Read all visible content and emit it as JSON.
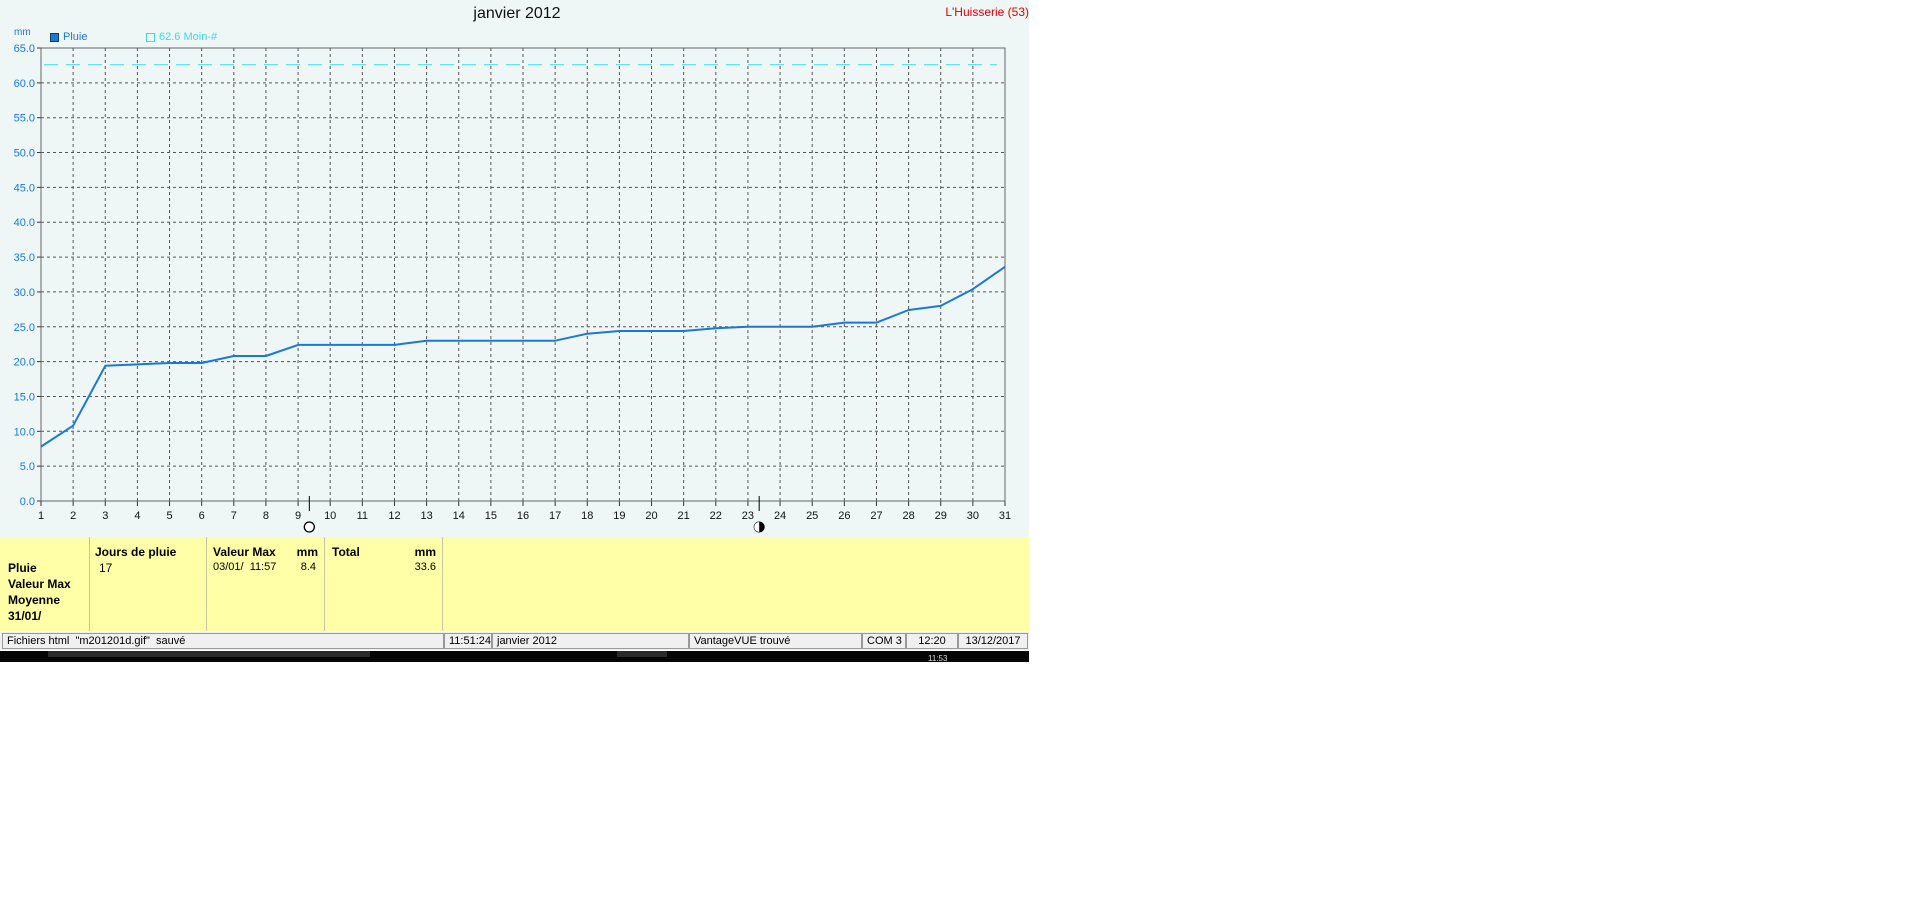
{
  "chart_data": {
    "type": "line",
    "title": "janvier 2012",
    "ylabel": "mm",
    "xlabel": "",
    "ylim": [
      0,
      65
    ],
    "xlim": [
      1,
      31
    ],
    "y_ticks": [
      "0.0",
      "5.0",
      "10.0",
      "15.0",
      "20.0",
      "25.0",
      "30.0",
      "35.0",
      "40.0",
      "45.0",
      "50.0",
      "55.0",
      "60.0",
      "65.0"
    ],
    "x_ticks": [
      "1",
      "2",
      "3",
      "4",
      "5",
      "6",
      "7",
      "8",
      "9",
      "10",
      "11",
      "12",
      "13",
      "14",
      "15",
      "16",
      "17",
      "18",
      "19",
      "20",
      "21",
      "22",
      "23",
      "24",
      "25",
      "26",
      "27",
      "28",
      "29",
      "30",
      "31"
    ],
    "grid": true,
    "legend_placement": "top-left",
    "series": [
      {
        "name": "Pluie",
        "color": "#1a78d6",
        "x": [
          1,
          2,
          3,
          4,
          5,
          6,
          7,
          8,
          9,
          10,
          11,
          12,
          13,
          14,
          15,
          16,
          17,
          18,
          19,
          20,
          21,
          22,
          23,
          24,
          25,
          26,
          27,
          28,
          29,
          30,
          31
        ],
        "values": [
          7.8,
          10.8,
          19.4,
          19.6,
          19.8,
          19.8,
          20.8,
          20.8,
          22.4,
          22.4,
          22.4,
          22.4,
          23.0,
          23.0,
          23.0,
          23.0,
          23.0,
          24.0,
          24.4,
          24.4,
          24.4,
          24.8,
          25.0,
          25.0,
          25.0,
          25.6,
          25.6,
          27.4,
          28.0,
          30.4,
          33.6
        ]
      }
    ],
    "reference_line": {
      "label": "62.6 Moin-#",
      "value": 62.6,
      "color": "#3fd8e8"
    },
    "moon_markers": [
      {
        "x": 9.35,
        "phase": "full"
      },
      {
        "x": 23.35,
        "phase": "last-quarter"
      }
    ]
  },
  "station": "L'Huisserie (53)",
  "stats": {
    "row_labels": [
      "Pluie",
      "Valeur Max",
      "Moyenne",
      "31/01/"
    ],
    "days_header": "Jours de pluie",
    "days_value": "17",
    "max_header": "Valeur Max",
    "max_unit": "mm",
    "max_date": "03/01/  11:57",
    "max_value": "8.4",
    "total_header": "Total",
    "total_unit": "mm",
    "total_value": "33.6"
  },
  "status": {
    "message": "Fichiers html  \"m201201d.gif\"  sauvé",
    "time": "11:51:24",
    "period": "janvier 2012",
    "station_status": "VantageVUE trouvé",
    "port": "COM 3",
    "clock": "12:20",
    "date": "13/12/2017"
  },
  "taskbar": {
    "clock": "11:53"
  }
}
